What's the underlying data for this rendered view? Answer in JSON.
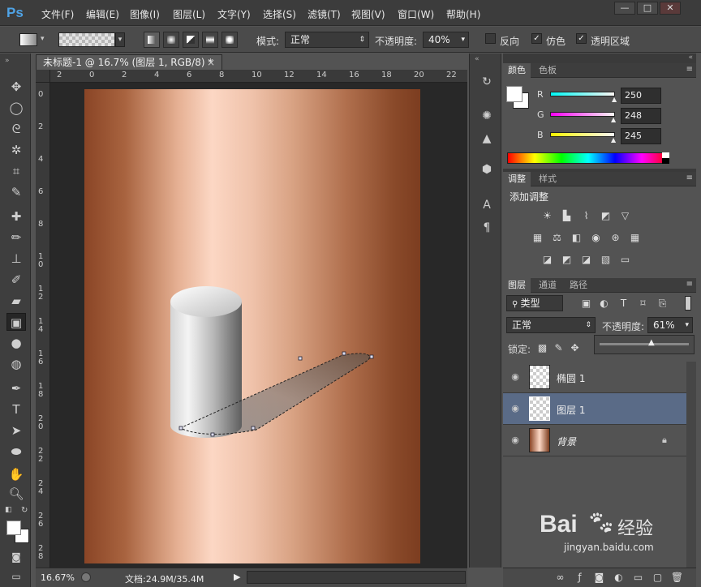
{
  "app": {
    "logo": "Ps"
  },
  "menu": [
    "文件(F)",
    "编辑(E)",
    "图像(I)",
    "图层(L)",
    "文字(Y)",
    "选择(S)",
    "滤镜(T)",
    "视图(V)",
    "窗口(W)",
    "帮助(H)"
  ],
  "window_controls": {
    "minimize": "—",
    "maximize": "□",
    "close": "✕"
  },
  "options": {
    "mode_label": "模式:",
    "mode_value": "正常",
    "opacity_label": "不透明度:",
    "opacity_value": "40%",
    "reverse": "反向",
    "dither": "仿色",
    "transparency": "透明区域",
    "reverse_checked": false,
    "dither_checked": true,
    "transparency_checked": true
  },
  "document": {
    "tab_title": "未标题-1 @ 16.7% (图层 1, RGB/8) *",
    "tab_close": "×",
    "zoom": "16.67%",
    "doc_info": "文档:24.9M/35.4M",
    "ruler_h": [
      "2",
      "0",
      "2",
      "4",
      "6",
      "8",
      "10",
      "12",
      "14",
      "16",
      "18",
      "20",
      "22"
    ],
    "ruler_v": [
      "0",
      "2",
      "4",
      "6",
      "8",
      "1\n0",
      "1\n2",
      "1\n4",
      "1\n6",
      "1\n8",
      "2\n0",
      "2\n2",
      "2\n4",
      "2\n6",
      "2\n8"
    ]
  },
  "color_panel": {
    "tabs": [
      "颜色",
      "色板"
    ],
    "r_label": "R",
    "g_label": "G",
    "b_label": "B",
    "r": "250",
    "g": "248",
    "b": "245"
  },
  "adjustments_panel": {
    "tabs": [
      "调整",
      "样式"
    ],
    "title": "添加调整"
  },
  "layers_panel": {
    "tabs": [
      "图层",
      "通道",
      "路径"
    ],
    "filter": "类型",
    "blend_mode": "正常",
    "opacity_label": "不透明度:",
    "opacity_value": "61%",
    "lock_label": "锁定:",
    "layers": [
      {
        "name": "椭圆 1",
        "selected": false
      },
      {
        "name": "图层 1",
        "selected": true
      },
      {
        "name": "背景",
        "selected": false,
        "locked": true
      }
    ]
  },
  "watermark": {
    "brand": "Bai",
    "brand2": "经验",
    "url": "jingyan.baidu.com"
  }
}
